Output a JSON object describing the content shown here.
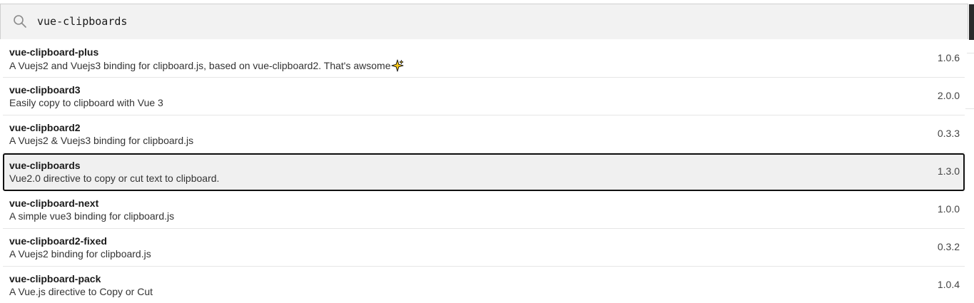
{
  "search": {
    "value": "vue-clipboards",
    "icon": "search-icon"
  },
  "results": [
    {
      "name": "vue-clipboard-plus",
      "description": "A Vuejs2 and Vuejs3 binding for clipboard.js, based on vue-clipboard2. That's awsome",
      "version": "1.0.6",
      "trailing_icon": "sparkle-icon"
    },
    {
      "name": "vue-clipboard3",
      "description": "Easily copy to clipboard with Vue 3",
      "version": "2.0.0"
    },
    {
      "name": "vue-clipboard2",
      "description": "A Vuejs2 & Vuejs3 binding for clipboard.js",
      "version": "0.3.3"
    },
    {
      "name": "vue-clipboards",
      "description": "Vue2.0 directive to copy or cut text to clipboard.",
      "version": "1.3.0",
      "selected": true
    },
    {
      "name": "vue-clipboard-next",
      "description": "A simple vue3 binding for clipboard.js",
      "version": "1.0.0"
    },
    {
      "name": "vue-clipboard2-fixed",
      "description": "A Vuejs2 binding for clipboard.js",
      "version": "0.3.2"
    },
    {
      "name": "vue-clipboard-pack",
      "description": "A Vue.js directive to Copy or Cut",
      "version": "1.0.4"
    }
  ],
  "colors": {
    "search_bg": "#f2f2f2",
    "selected_bg": "#f0f0f0",
    "selected_border": "#111111",
    "sparkle": "#f5c518"
  }
}
